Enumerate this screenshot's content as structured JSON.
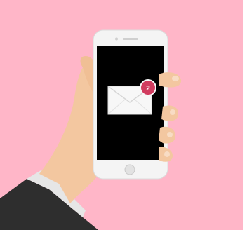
{
  "illustration": {
    "background_color": "#ffb6c8",
    "phone_body_color": "#f4f4f4",
    "screen_color": "#000000",
    "envelope_color": "#f7f7f7",
    "notification": {
      "count": "2",
      "badge_color": "#d13c5f"
    },
    "hand_color": "#f3c7a0",
    "sleeve_color": "#2d2d2d",
    "cuff_color": "#e9e9e9"
  }
}
